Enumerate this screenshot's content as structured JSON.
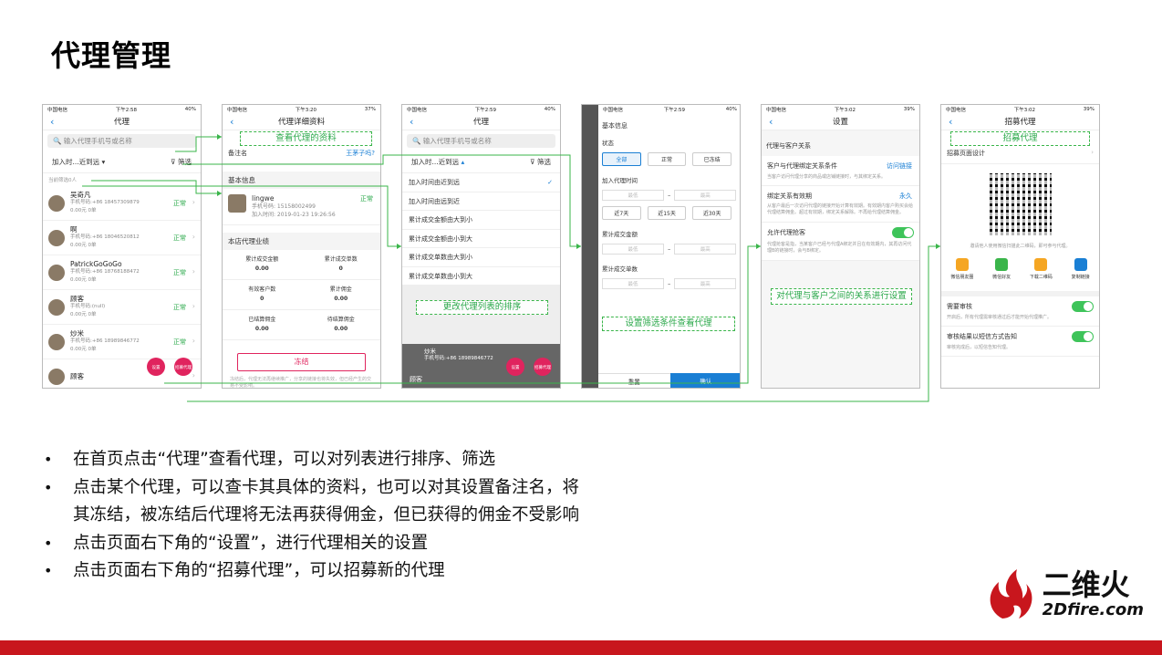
{
  "page": {
    "title": "代理管理",
    "bullets": [
      "在首页点击“代理”查看代理，可以对列表进行排序、筛选",
      "点击某个代理，可以查卡其具体的资料，也可以对其设置备注名，将",
      "其冻结，被冻结后代理将无法再获得佣金，但已获得的佣金不受影响",
      "点击页面右下角的“设置”，进行代理相关的设置",
      "点击页面右下角的“招募代理”，可以招募新的代理"
    ],
    "logo_cn": "二维火",
    "logo_en": "2Dfire.com"
  },
  "annotations": {
    "view_profile": "查看代理的资料",
    "sort_list": "更改代理列表的排序",
    "filter": "设置筛选条件查看代理",
    "relation": "对代理与客户之间的关系进行设置",
    "recruit": "招募代理"
  },
  "screen1": {
    "status_left": "中国电信",
    "status_time": "下午2:58",
    "status_right": "40%",
    "nav_title": "代理",
    "search_placeholder": "输入代理手机号或名称",
    "sort_label": "加入时...近到远",
    "filter_label": "筛选",
    "count_label": "当前筛选0人",
    "agents": [
      {
        "name": "吴奇凡",
        "phone": "手机号码:+86 18457309879",
        "stats": "0.00元       0单",
        "status": "正常"
      },
      {
        "name": "啊",
        "phone": "手机号码:+86 18046520812",
        "stats": "0.00元       0单",
        "status": "正常"
      },
      {
        "name": "PatrickGoGoGo",
        "phone": "手机号码:+86 18768188472",
        "stats": "0.00元       0单",
        "status": "正常"
      },
      {
        "name": "顾客",
        "phone": "手机号码:(null)",
        "stats": "0.00元       0单",
        "status": "正常"
      },
      {
        "name": "炒米",
        "phone": "手机号码:+86 18989846772",
        "stats": "0.00元       0单",
        "status": "正常"
      },
      {
        "name": "顾客",
        "phone": "",
        "stats": "",
        "status": ""
      }
    ],
    "fab_settings": "设置",
    "fab_recruit": "招募代理"
  },
  "screen2": {
    "status_time": "下午3:20",
    "status_right": "37%",
    "nav_title": "代理详细资料",
    "remark_label": "备注名",
    "remark_link": "王茅子吗?",
    "basic_info": "基本信息",
    "name": "lingwe",
    "phone": "手机号码: 15158002499",
    "join": "加入时间: 2019-01-23 19:26:56",
    "status": "正常",
    "perf_title": "本店代理业绩",
    "stats": [
      {
        "label": "累计成交金额",
        "value": "0.00"
      },
      {
        "label": "累计成交单数",
        "value": "0"
      },
      {
        "label": "有效客户数",
        "value": "0"
      },
      {
        "label": "累计佣金",
        "value": "0.00"
      },
      {
        "label": "已结算佣金",
        "value": "0.00"
      },
      {
        "label": "待结算佣金",
        "value": "0.00"
      }
    ],
    "freeze_button": "冻结",
    "note": "冻结后，代理无法再继续推广，分享的链接也将失效，但已经产生的交易不受影响。"
  },
  "screen3": {
    "status_time": "下午2:59",
    "status_right": "40%",
    "nav_title": "代理",
    "search_placeholder": "输入代理手机号或名称",
    "sort_label": "加入时...近到远",
    "filter_label": "筛选",
    "sort_options": [
      "加入时间由近到远",
      "加入时间由远到近",
      "累计成交金额由大到小",
      "累计成交金额由小到大",
      "累计成交单数由大到小",
      "累计成交单数由小到大"
    ],
    "bottom_name": "炒米",
    "bottom_phone": "手机号码:+86 18989846772",
    "bottom_name2": "顾客"
  },
  "screen4": {
    "status_time": "下午2:59",
    "status_right": "40%",
    "basic": "基本信息",
    "state_label": "状态",
    "states": [
      "全部",
      "正常",
      "已冻结"
    ],
    "join_label": "加入代理时间",
    "min": "最低",
    "max": "最高",
    "ranges": [
      "近7天",
      "近15天",
      "近30天"
    ],
    "amount_label": "累计成交金额",
    "orders_label": "累计成交单数",
    "reset": "重置",
    "confirm": "确认"
  },
  "screen5": {
    "status_time": "下午3:02",
    "status_right": "39%",
    "nav_title": "设置",
    "section": "代理与客户关系",
    "item1_title": "客户与代理绑定关系条件",
    "item1_value": "访问链接",
    "item1_desc": "当客户访问代理分享的商品或店铺链接时，与其绑定关系。",
    "item2_title": "绑定关系有效期",
    "item2_value": "永久",
    "item2_desc": "从客户最后一次访问代理的链接开始计算有效期。有效期内客户购买会给代理结算佣金。超过有效期，绑定关系解除。不再给代理结算佣金。",
    "item3_title": "允许代理抢客",
    "item3_desc": "代理抢客是指，当某客户已经与代理A绑定并且在有效期内，其再访问代理B的链接时，会与B绑定。"
  },
  "screen6": {
    "status_time": "下午3:02",
    "status_right": "39%",
    "nav_title": "招募代理",
    "design": "招募页面设计",
    "invite": "邀请他人使用微信扫描此二维码，即可参与代理。",
    "share": [
      "微信朋友圈",
      "微信好友",
      "下载二维码",
      "复制链接"
    ],
    "audit_title": "需要审核",
    "audit_desc": "开启后，所有代理需审核通过后才能开始代理推广。",
    "notify_title": "审核结果以短信方式告知",
    "notify_desc": "审核完成后，以短信告知代理。"
  },
  "colors": {
    "accent": "#1a7fd4",
    "green": "#2aa84a",
    "red": "#e0245e",
    "brand": "#c8161d"
  }
}
